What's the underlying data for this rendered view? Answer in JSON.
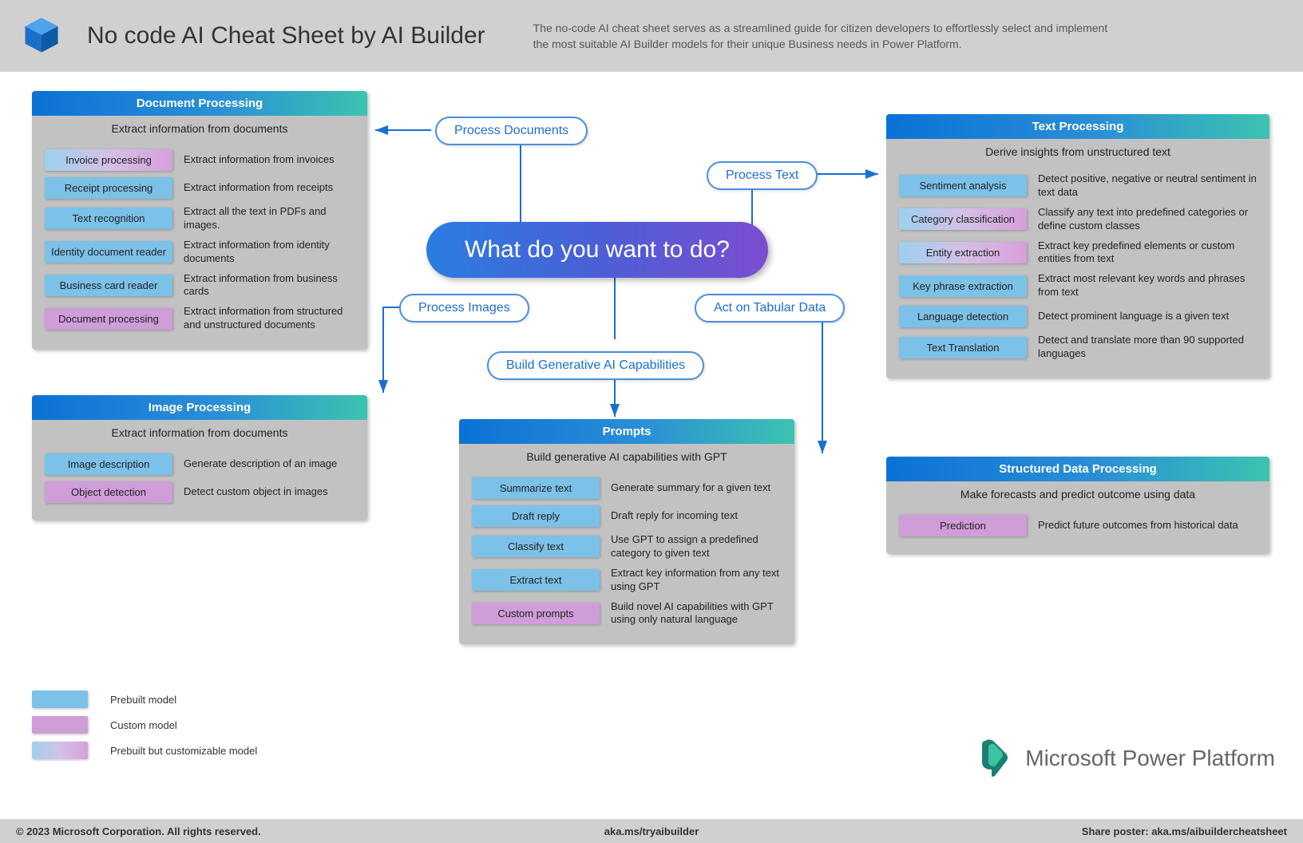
{
  "header": {
    "title": "No code AI Cheat Sheet by AI Builder",
    "subtitle": "The no-code AI cheat sheet serves as a streamlined guide for citizen developers to effortlessly select and implement the most suitable AI Builder models for their unique Business needs in Power Platform."
  },
  "footer": {
    "left": "© 2023 Microsoft Corporation. All rights reserved.",
    "center": "aka.ms/tryaibuilder",
    "right": "Share poster: aka.ms/aibuildercheatsheet"
  },
  "hub": {
    "question": "What do you want to do?"
  },
  "actions": {
    "documents": "Process Documents",
    "text": "Process Text",
    "images": "Process Images",
    "tabular": "Act on Tabular Data",
    "generative": "Build Generative AI Capabilities"
  },
  "panels": {
    "document": {
      "title": "Document Processing",
      "subtitle": "Extract information from documents",
      "items": [
        {
          "label": "Invoice processing",
          "type": "mixed",
          "desc": "Extract information from invoices"
        },
        {
          "label": "Receipt processing",
          "type": "prebuilt",
          "desc": "Extract information from receipts"
        },
        {
          "label": "Text  recognition",
          "type": "prebuilt",
          "desc": "Extract all the text in PDFs and images."
        },
        {
          "label": "Identity document reader",
          "type": "prebuilt",
          "desc": "Extract information from identity documents"
        },
        {
          "label": "Business card reader",
          "type": "prebuilt",
          "desc": "Extract information from business cards"
        },
        {
          "label": "Document processing",
          "type": "custom",
          "desc": "Extract information from structured and unstructured documents"
        }
      ]
    },
    "image": {
      "title": "Image Processing",
      "subtitle": "Extract information from documents",
      "items": [
        {
          "label": "Image description",
          "type": "prebuilt",
          "desc": "Generate description of an image"
        },
        {
          "label": "Object detection",
          "type": "custom",
          "desc": "Detect custom object in images"
        }
      ]
    },
    "prompts": {
      "title": "Prompts",
      "subtitle": "Build generative AI capabilities with GPT",
      "items": [
        {
          "label": "Summarize text",
          "type": "prebuilt",
          "desc": "Generate summary for a given text"
        },
        {
          "label": "Draft reply",
          "type": "prebuilt",
          "desc": "Draft reply for incoming text"
        },
        {
          "label": "Classify text",
          "type": "prebuilt",
          "desc": "Use GPT to assign a predefined category to given text"
        },
        {
          "label": "Extract text",
          "type": "prebuilt",
          "desc": "Extract key information from any text using GPT"
        },
        {
          "label": "Custom prompts",
          "type": "custom",
          "desc": "Build novel AI capabilities with GPT using only natural language"
        }
      ]
    },
    "text": {
      "title": "Text Processing",
      "subtitle": "Derive insights from unstructured text",
      "items": [
        {
          "label": "Sentiment analysis",
          "type": "prebuilt",
          "desc": "Detect positive, negative or neutral sentiment in text data"
        },
        {
          "label": "Category classification",
          "type": "mixed",
          "desc": "Classify any text into predefined categories or define custom classes"
        },
        {
          "label": "Entity extraction",
          "type": "mixed",
          "desc": "Extract key predefined elements or custom entities from text"
        },
        {
          "label": "Key phrase extraction",
          "type": "prebuilt",
          "desc": "Extract most relevant key words and phrases from text"
        },
        {
          "label": "Language detection",
          "type": "prebuilt",
          "desc": "Detect prominent language is a given text"
        },
        {
          "label": "Text Translation",
          "type": "prebuilt",
          "desc": "Detect and translate more than 90 supported languages"
        }
      ]
    },
    "structured": {
      "title": "Structured Data Processing",
      "subtitle": "Make forecasts and predict outcome using data",
      "items": [
        {
          "label": "Prediction",
          "type": "custom",
          "desc": "Predict future outcomes from historical data"
        }
      ]
    }
  },
  "legend": {
    "prebuilt": "Prebuilt model",
    "custom": "Custom model",
    "mixed": "Prebuilt but customizable model"
  },
  "brand": {
    "text": "Microsoft Power Platform"
  }
}
